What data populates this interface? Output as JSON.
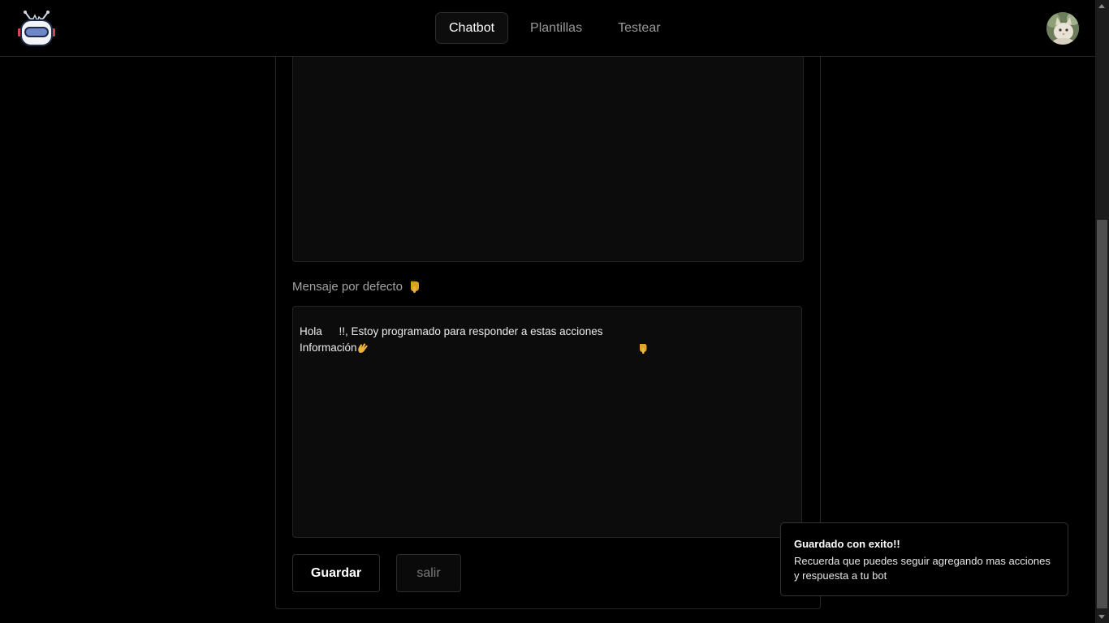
{
  "header": {
    "logo_icon": "robot-logo-icon",
    "tabs": [
      {
        "label": "Chatbot",
        "active": true
      },
      {
        "label": "Plantillas",
        "active": false
      },
      {
        "label": "Testear",
        "active": false
      }
    ],
    "avatar_icon": "user-avatar"
  },
  "form": {
    "default_message_label": "Mensaje por defecto",
    "label_icon": "pointing-down-hand-icon",
    "default_message": {
      "line1_prefix": "Hola",
      "line1_wave_icon": "waving-hand-icon",
      "line1_middle": "!!, Estoy programado para responder a estas acciones",
      "line1_point_icon": "pointing-down-hand-icon",
      "line2": "Información"
    },
    "save_label": "Guardar",
    "exit_label": "salir"
  },
  "toast": {
    "title": "Guardado con exito!!",
    "body": "Recuerda que puedes seguir agregando mas acciones y respuesta a tu bot"
  },
  "colors": {
    "background": "#000000",
    "panel": "#0c0c0c",
    "border": "#262626",
    "accent_emoji": "#d9a21b"
  }
}
